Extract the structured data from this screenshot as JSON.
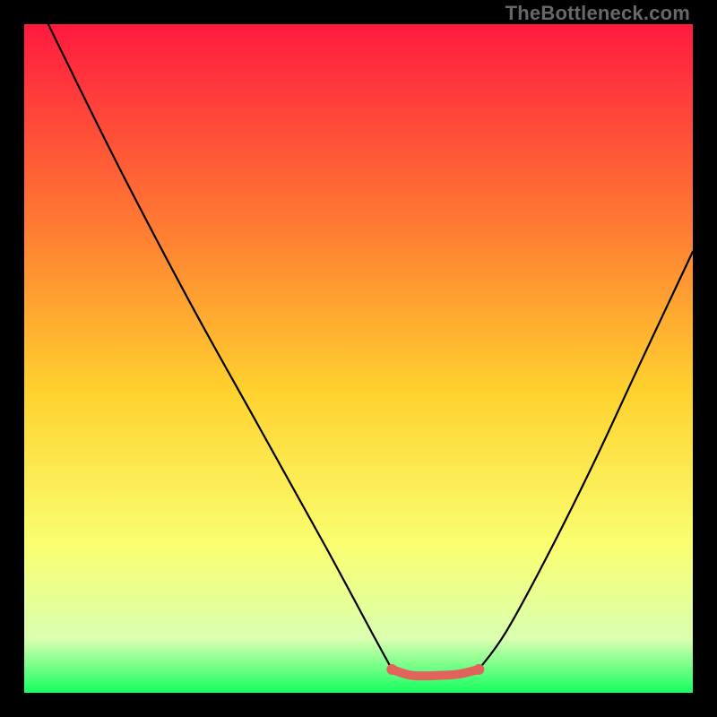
{
  "watermark": "TheBottleneck.com",
  "chart_data": {
    "type": "line",
    "title": "",
    "xlabel": "",
    "ylabel": "",
    "xlim": [
      0,
      100
    ],
    "ylim": [
      0,
      100
    ],
    "grid": false,
    "legend_position": "none",
    "gradient_colors": {
      "top": "#ff1a3f",
      "mid_upper": "#ff7a33",
      "mid": "#ffd22e",
      "mid_lower": "#faff71",
      "near_bottom": "#d9ffb0",
      "bottom": "#14ff5f"
    },
    "series": [
      {
        "name": "left-branch",
        "color": "#000000",
        "points": [
          {
            "x": 3.6,
            "y": 100.0
          },
          {
            "x": 8.0,
            "y": 91.0
          },
          {
            "x": 15.0,
            "y": 77.0
          },
          {
            "x": 25.0,
            "y": 58.0
          },
          {
            "x": 35.0,
            "y": 40.0
          },
          {
            "x": 45.0,
            "y": 22.0
          },
          {
            "x": 52.0,
            "y": 9.0
          },
          {
            "x": 55.0,
            "y": 3.5
          }
        ]
      },
      {
        "name": "right-branch",
        "color": "#000000",
        "points": [
          {
            "x": 68.0,
            "y": 3.5
          },
          {
            "x": 72.0,
            "y": 9.0
          },
          {
            "x": 78.0,
            "y": 20.0
          },
          {
            "x": 85.0,
            "y": 34.0
          },
          {
            "x": 92.0,
            "y": 49.0
          },
          {
            "x": 100.0,
            "y": 66.0
          }
        ]
      },
      {
        "name": "highlight-trough",
        "color": "#e2635c",
        "thickness": 10,
        "points": [
          {
            "x": 55.0,
            "y": 3.5
          },
          {
            "x": 58.0,
            "y": 2.6
          },
          {
            "x": 62.0,
            "y": 2.6
          },
          {
            "x": 65.0,
            "y": 2.8
          },
          {
            "x": 68.0,
            "y": 3.5
          }
        ]
      }
    ]
  }
}
